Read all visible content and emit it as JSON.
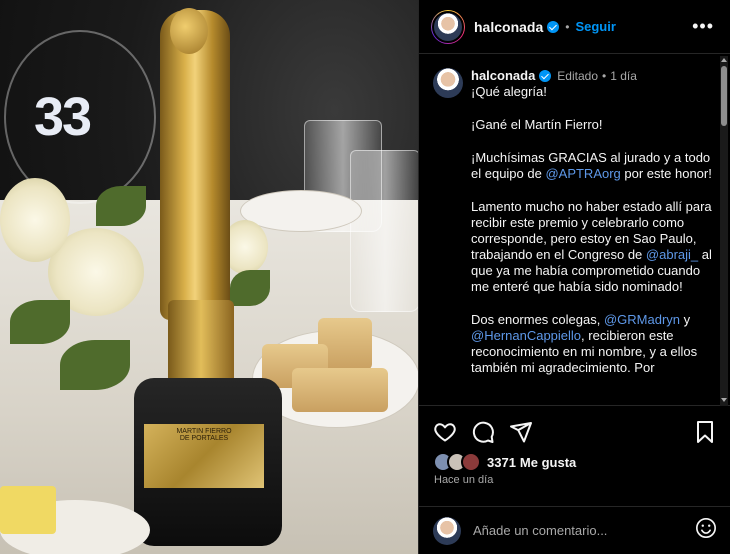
{
  "post": {
    "photo_table_number": "33",
    "plaque": {
      "line1": "MARTIN FIERRO",
      "line2": "DE PORTALES"
    }
  },
  "header": {
    "username": "halconada",
    "follow_label": "Seguir",
    "more_label": "•••"
  },
  "caption": {
    "username": "halconada",
    "edited_label": "Editado",
    "time": "1 día",
    "paragraphs": [
      {
        "parts": [
          {
            "t": "¡Qué alegría!"
          }
        ]
      },
      {
        "parts": [
          {
            "t": "¡Gané el Martín Fierro!"
          }
        ]
      },
      {
        "parts": [
          {
            "t": "¡Muchísimas GRACIAS al jurado y a todo el equipo de "
          },
          {
            "t": "@APTRAorg",
            "m": true
          },
          {
            "t": " por este honor!"
          }
        ]
      },
      {
        "parts": [
          {
            "t": "Lamento mucho no haber estado allí para recibir este premio y celebrarlo como corresponde, pero estoy en Sao Paulo, trabajando en el Congreso de "
          },
          {
            "t": "@abraji_",
            "m": true
          },
          {
            "t": " al que ya me había comprometido cuando me enteré que había sido nominado!"
          }
        ]
      },
      {
        "parts": [
          {
            "t": "Dos enormes colegas, "
          },
          {
            "t": "@GRMadryn",
            "m": true
          },
          {
            "t": " y "
          },
          {
            "t": "@HernanCappiello",
            "m": true
          },
          {
            "t": ", recibieron este reconocimiento en mi nombre, y a ellos también mi agradecimiento. Por"
          }
        ]
      }
    ]
  },
  "actions": {
    "like_icon": "heart-icon",
    "comment_icon": "comment-icon",
    "share_icon": "share-icon",
    "save_icon": "bookmark-icon"
  },
  "likes": {
    "count": "3371",
    "label": "Me gusta"
  },
  "timestamp": "Hace un día",
  "comment": {
    "placeholder": "Añade un comentario...",
    "emoji_icon": "emoji-icon"
  },
  "colors": {
    "link": "#5e98e8",
    "accent": "#0095f6",
    "background": "#000000"
  }
}
